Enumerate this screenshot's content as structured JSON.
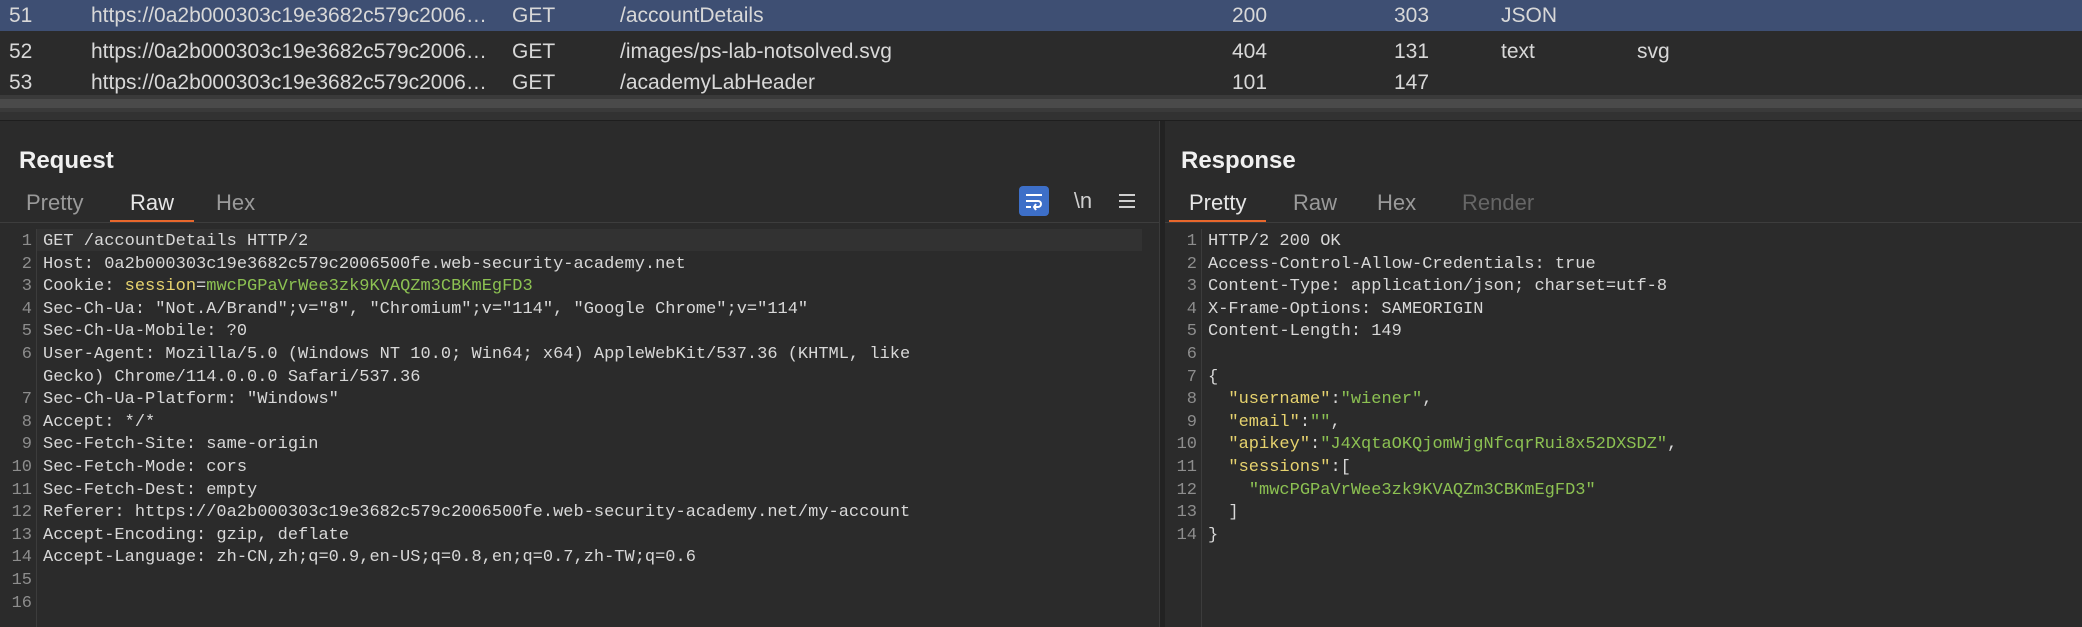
{
  "history": {
    "rows": [
      {
        "num": "51",
        "host": "https://0a2b000303c19e3682c579c2006…",
        "method": "GET",
        "url": "/accountDetails",
        "status": "200",
        "length": "303",
        "mime": "JSON",
        "ext": ""
      },
      {
        "num": "52",
        "host": "https://0a2b000303c19e3682c579c2006…",
        "method": "GET",
        "url": "/images/ps-lab-notsolved.svg",
        "status": "404",
        "length": "131",
        "mime": "text",
        "ext": "svg"
      },
      {
        "num": "53",
        "host": "https://0a2b000303c19e3682c579c2006…",
        "method": "GET",
        "url": "/academyLabHeader",
        "status": "101",
        "length": "147",
        "mime": "",
        "ext": ""
      }
    ]
  },
  "request": {
    "title": "Request",
    "tabs": [
      "Pretty",
      "Raw",
      "Hex"
    ],
    "active_tab": "Raw",
    "tools": {
      "wrap_icon": "wrap-lines-icon",
      "newline_label": "\\n",
      "menu_icon": "hamburger-menu-icon"
    },
    "lines": [
      {
        "n": "1",
        "parts": [
          {
            "t": "GET /accountDetails HTTP/2",
            "c": "k"
          }
        ]
      },
      {
        "n": "2",
        "parts": [
          {
            "t": "Host: 0a2b000303c19e3682c579c2006500fe.web-security-academy.net",
            "c": "k"
          }
        ]
      },
      {
        "n": "3",
        "parts": [
          {
            "t": "Cookie: ",
            "c": "k"
          },
          {
            "t": "session",
            "c": "y"
          },
          {
            "t": "=",
            "c": "k"
          },
          {
            "t": "mwcPGPaVrWee3zk9KVAQZm3CBKmEgFD3",
            "c": "g"
          }
        ]
      },
      {
        "n": "4",
        "parts": [
          {
            "t": "Sec-Ch-Ua: \"Not.A/Brand\";v=\"8\", \"Chromium\";v=\"114\", \"Google Chrome\";v=\"114\"",
            "c": "k"
          }
        ]
      },
      {
        "n": "5",
        "parts": [
          {
            "t": "Sec-Ch-Ua-Mobile: ?0",
            "c": "k"
          }
        ]
      },
      {
        "n": "6",
        "parts": [
          {
            "t": "User-Agent: Mozilla/5.0 (Windows NT 10.0; Win64; x64) AppleWebKit/537.36 (KHTML, like",
            "c": "k"
          }
        ]
      },
      {
        "n": "",
        "parts": [
          {
            "t": "Gecko) Chrome/114.0.0.0 Safari/537.36",
            "c": "k"
          }
        ]
      },
      {
        "n": "7",
        "parts": [
          {
            "t": "Sec-Ch-Ua-Platform: \"Windows\"",
            "c": "k"
          }
        ]
      },
      {
        "n": "8",
        "parts": [
          {
            "t": "Accept: */*",
            "c": "k"
          }
        ]
      },
      {
        "n": "9",
        "parts": [
          {
            "t": "Sec-Fetch-Site: same-origin",
            "c": "k"
          }
        ]
      },
      {
        "n": "10",
        "parts": [
          {
            "t": "Sec-Fetch-Mode: cors",
            "c": "k"
          }
        ]
      },
      {
        "n": "11",
        "parts": [
          {
            "t": "Sec-Fetch-Dest: empty",
            "c": "k"
          }
        ]
      },
      {
        "n": "12",
        "parts": [
          {
            "t": "Referer: https://0a2b000303c19e3682c579c2006500fe.web-security-academy.net/my-account",
            "c": "k"
          }
        ]
      },
      {
        "n": "13",
        "parts": [
          {
            "t": "Accept-Encoding: gzip, deflate",
            "c": "k"
          }
        ]
      },
      {
        "n": "14",
        "parts": [
          {
            "t": "Accept-Language: zh-CN,zh;q=0.9,en-US;q=0.8,en;q=0.7,zh-TW;q=0.6",
            "c": "k"
          }
        ]
      },
      {
        "n": "15",
        "parts": []
      },
      {
        "n": "16",
        "parts": []
      }
    ]
  },
  "response": {
    "title": "Response",
    "tabs": [
      "Pretty",
      "Raw",
      "Hex",
      "Render"
    ],
    "active_tab": "Pretty",
    "disabled_tab": "Render",
    "lines": [
      {
        "n": "1",
        "parts": [
          {
            "t": "HTTP/2 200 OK",
            "c": "k"
          }
        ]
      },
      {
        "n": "2",
        "parts": [
          {
            "t": "Access-Control-Allow-Credentials: true",
            "c": "k"
          }
        ]
      },
      {
        "n": "3",
        "parts": [
          {
            "t": "Content-Type: application/json; charset=utf-8",
            "c": "k"
          }
        ]
      },
      {
        "n": "4",
        "parts": [
          {
            "t": "X-Frame-Options: SAMEORIGIN",
            "c": "k"
          }
        ]
      },
      {
        "n": "5",
        "parts": [
          {
            "t": "Content-Length: 149",
            "c": "k"
          }
        ]
      },
      {
        "n": "6",
        "parts": []
      },
      {
        "n": "7",
        "parts": [
          {
            "t": "{",
            "c": "k"
          }
        ]
      },
      {
        "n": "8",
        "parts": [
          {
            "t": "  ",
            "c": "k"
          },
          {
            "t": "\"username\"",
            "c": "y"
          },
          {
            "t": ":",
            "c": "k"
          },
          {
            "t": "\"wiener\"",
            "c": "g"
          },
          {
            "t": ",",
            "c": "k"
          }
        ]
      },
      {
        "n": "9",
        "parts": [
          {
            "t": "  ",
            "c": "k"
          },
          {
            "t": "\"email\"",
            "c": "y"
          },
          {
            "t": ":",
            "c": "k"
          },
          {
            "t": "\"\"",
            "c": "g"
          },
          {
            "t": ",",
            "c": "k"
          }
        ]
      },
      {
        "n": "10",
        "parts": [
          {
            "t": "  ",
            "c": "k"
          },
          {
            "t": "\"apikey\"",
            "c": "y"
          },
          {
            "t": ":",
            "c": "k"
          },
          {
            "t": "\"J4XqtaOKQjomWjgNfcqrRui8x52DXSDZ\"",
            "c": "g"
          },
          {
            "t": ",",
            "c": "k"
          }
        ]
      },
      {
        "n": "11",
        "parts": [
          {
            "t": "  ",
            "c": "k"
          },
          {
            "t": "\"sessions\"",
            "c": "y"
          },
          {
            "t": ":[",
            "c": "k"
          }
        ]
      },
      {
        "n": "12",
        "parts": [
          {
            "t": "    ",
            "c": "k"
          },
          {
            "t": "\"mwcPGPaVrWee3zk9KVAQZm3CBKmEgFD3\"",
            "c": "g"
          }
        ]
      },
      {
        "n": "13",
        "parts": [
          {
            "t": "  ]",
            "c": "k"
          }
        ]
      },
      {
        "n": "14",
        "parts": [
          {
            "t": "}",
            "c": "k"
          }
        ]
      }
    ]
  },
  "colors": {
    "selected_row": "#3e4f73",
    "accent": "#e8672c",
    "json_key": "#e6d26e",
    "json_string": "#8cc152"
  }
}
